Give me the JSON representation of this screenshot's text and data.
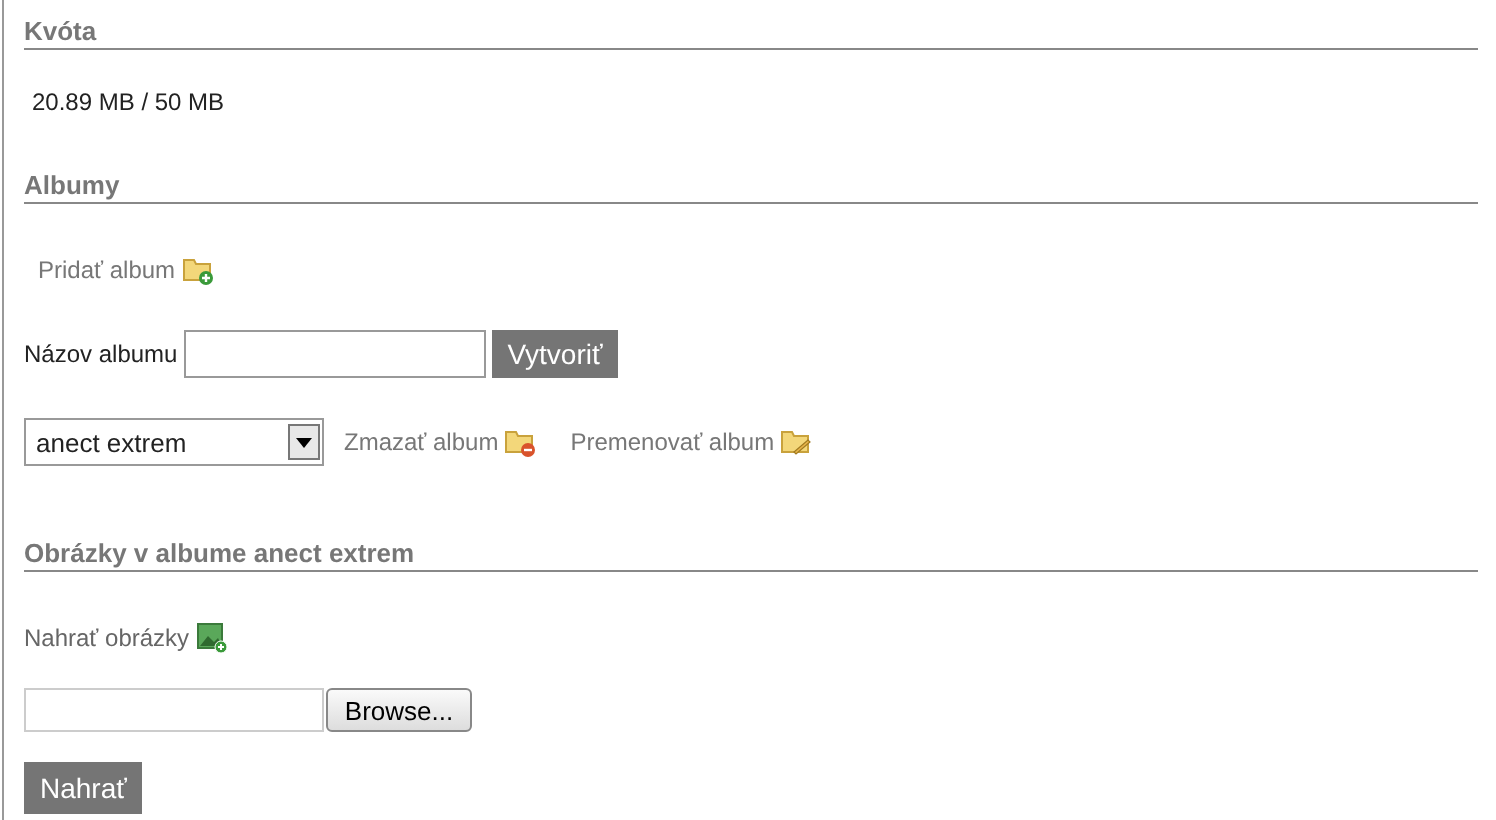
{
  "quota": {
    "heading": "Kvóta",
    "usage": "20.89 MB / 50 MB"
  },
  "albums": {
    "heading": "Albumy",
    "add_link": "Pridať album",
    "name_label": "Názov albumu",
    "create_button": "Vytvoriť",
    "selected_album": "anect extrem",
    "delete_link": "Zmazať album",
    "rename_link": "Premenovať album"
  },
  "images": {
    "heading": "Obrázky v albume anect extrem",
    "upload_link": "Nahrať obrázky",
    "browse_button": "Browse...",
    "upload_button": "Nahrať"
  }
}
